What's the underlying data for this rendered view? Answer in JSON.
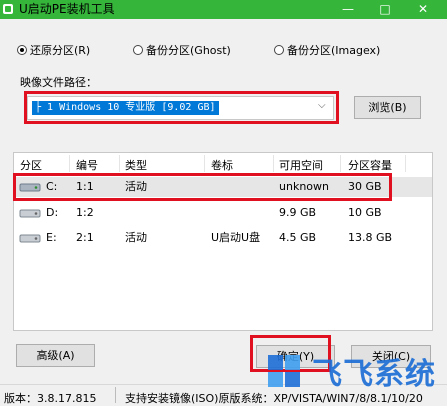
{
  "window": {
    "title": "U启动PE装机工具",
    "minimize": "—",
    "maximize": "□",
    "close": "✕"
  },
  "radio_options": [
    {
      "label": "还原分区(R)",
      "selected": true
    },
    {
      "label": "备份分区(Ghost)",
      "selected": false
    },
    {
      "label": "备份分区(Imagex)",
      "selected": false
    }
  ],
  "image_path": {
    "label": "映像文件路径：",
    "value": "├ 1 Windows 10 专业版 [9.02 GB]",
    "browse_label": "浏览(B)"
  },
  "table": {
    "columns": [
      "分区",
      "编号",
      "类型",
      "卷标",
      "可用空间",
      "分区容量"
    ],
    "rows": [
      {
        "partition": "C:",
        "number": "1:1",
        "type": "活动",
        "label": "",
        "free": "unknown",
        "capacity": "30 GB"
      },
      {
        "partition": "D:",
        "number": "1:2",
        "type": "",
        "label": "",
        "free": "9.9 GB",
        "capacity": "10 GB"
      },
      {
        "partition": "E:",
        "number": "2:1",
        "type": "活动",
        "label": "U启动U盘",
        "free": "4.5 GB",
        "capacity": "13.8 GB"
      }
    ]
  },
  "buttons": {
    "advanced": "高级(A)",
    "ok": "确定(Y)",
    "close": "关闭(C)"
  },
  "status": {
    "version": "版本：3.8.17.815",
    "support": "支持安装镜像(ISO)原版系统：XP/VISTA/WIN7/8/8.1/10/20"
  },
  "watermark": {
    "text": "飞飞系统"
  },
  "colors": {
    "titlebar": "#35b53a",
    "highlight": "#e01020",
    "selection": "#0078d7",
    "watermark": "#1e6fd6"
  }
}
